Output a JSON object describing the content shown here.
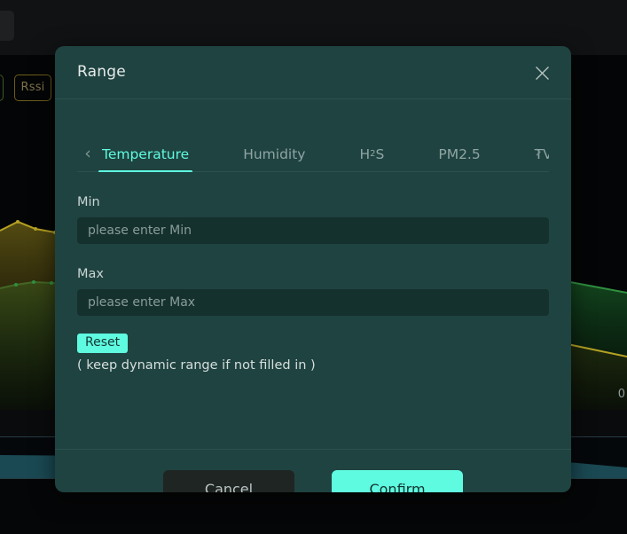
{
  "background": {
    "tag_rssi": "Rssi",
    "axis_label_partial": "0",
    "colors": {
      "panel": "#040506",
      "series_green": "#2e8b3f",
      "series_olive": "#b5a123",
      "brush": "#1f5560"
    }
  },
  "modal": {
    "title": "Range",
    "close_icon": "close-icon",
    "tabs": {
      "prev_arrow": "‹",
      "next_arrow": "›",
      "items": [
        {
          "label": "Temperature",
          "active": true
        },
        {
          "label": "Humidity",
          "active": false
        },
        {
          "label": "H",
          "sub": "2",
          "label_tail": "S",
          "active": false
        },
        {
          "label": "PM2.5",
          "active": false
        },
        {
          "label": "TVOC",
          "active": false
        }
      ],
      "active_index": 0,
      "active_color": "#5ffbe0"
    },
    "fields": {
      "min_label": "Min",
      "min_value": "",
      "min_placeholder": "please enter Min",
      "max_label": "Max",
      "max_value": "",
      "max_placeholder": "please enter Max"
    },
    "reset_label": "Reset",
    "hint": "( keep dynamic range if not filled in )",
    "footer": {
      "cancel_label": "Cancel",
      "confirm_label": "Confirm"
    }
  }
}
